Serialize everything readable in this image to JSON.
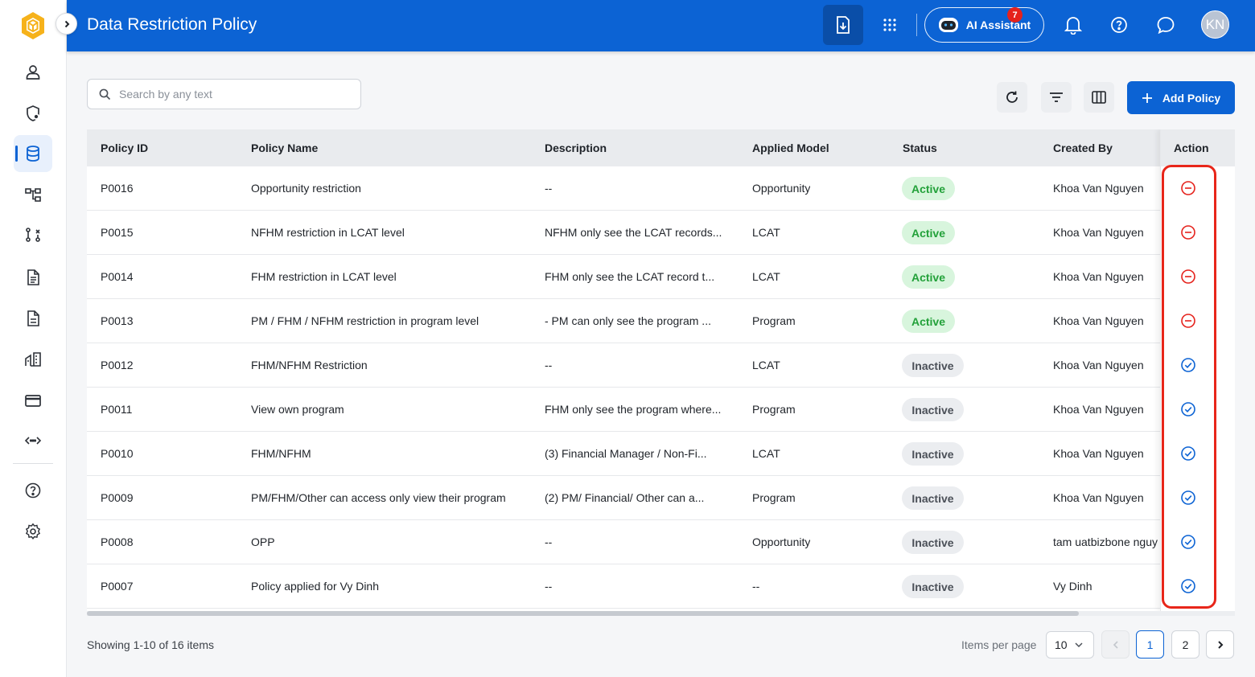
{
  "header": {
    "title": "Data Restriction Policy",
    "ai_label": "AI Assistant",
    "notification_count": "7",
    "avatar_initials": "KN"
  },
  "toolbar": {
    "search_placeholder": "Search by any text",
    "add_label": "Add Policy"
  },
  "sidebar": {
    "items": [
      "user-icon",
      "shield-icon",
      "database-icon",
      "hierarchy-icon",
      "workflow-icon",
      "document-icon",
      "file-icon",
      "buildings-icon",
      "card-icon",
      "code-icon",
      "help-icon",
      "settings-icon"
    ],
    "active": "database-icon"
  },
  "table": {
    "columns": [
      "Policy ID",
      "Policy Name",
      "Description",
      "Applied Model",
      "Status",
      "Created By",
      "Action"
    ],
    "rows": [
      {
        "id": "P0016",
        "name": "Opportunity restriction",
        "description": "--",
        "model": "Opportunity",
        "status": "Active",
        "created_by": "Khoa Van Nguyen",
        "action": "deactivate"
      },
      {
        "id": "P0015",
        "name": "NFHM restriction in LCAT level",
        "description": "NFHM only see the LCAT records...",
        "model": "LCAT",
        "status": "Active",
        "created_by": "Khoa Van Nguyen",
        "action": "deactivate"
      },
      {
        "id": "P0014",
        "name": "FHM restriction in LCAT level",
        "description": "FHM only see the LCAT record t...",
        "model": "LCAT",
        "status": "Active",
        "created_by": "Khoa Van Nguyen",
        "action": "deactivate"
      },
      {
        "id": "P0013",
        "name": "PM / FHM / NFHM restriction in program level",
        "description": "- PM can only see the program ...",
        "model": "Program",
        "status": "Active",
        "created_by": "Khoa Van Nguyen",
        "action": "deactivate"
      },
      {
        "id": "P0012",
        "name": "FHM/NFHM Restriction",
        "description": "--",
        "model": "LCAT",
        "status": "Inactive",
        "created_by": "Khoa Van Nguyen",
        "action": "activate"
      },
      {
        "id": "P0011",
        "name": "View own program",
        "description": "FHM only see the program where...",
        "model": "Program",
        "status": "Inactive",
        "created_by": "Khoa Van Nguyen",
        "action": "activate"
      },
      {
        "id": "P0010",
        "name": "FHM/NFHM",
        "description": "(3) Financial Manager / Non-Fi...",
        "model": "LCAT",
        "status": "Inactive",
        "created_by": "Khoa Van Nguyen",
        "action": "activate"
      },
      {
        "id": "P0009",
        "name": "PM/FHM/Other can access only view their program",
        "description": "(2) PM/ Financial/ Other can a...",
        "model": "Program",
        "status": "Inactive",
        "created_by": "Khoa Van Nguyen",
        "action": "activate"
      },
      {
        "id": "P0008",
        "name": "OPP",
        "description": "--",
        "model": "Opportunity",
        "status": "Inactive",
        "created_by": "tam uatbizbone nguy",
        "action": "activate"
      },
      {
        "id": "P0007",
        "name": "Policy applied for Vy Dinh",
        "description": "--",
        "model": "--",
        "status": "Inactive",
        "created_by": "Vy Dinh",
        "action": "activate"
      }
    ]
  },
  "footer": {
    "showing": "Showing 1-10 of 16 items",
    "items_per_page_label": "Items per page",
    "items_per_page": "10",
    "pages": [
      "1",
      "2"
    ],
    "current_page": "1"
  },
  "colors": {
    "brand": "#0c63d4",
    "active_status": "#23a13a",
    "deactivate_icon": "#e5221c",
    "activate_icon": "#0c63d4",
    "highlight": "#e8261a"
  }
}
